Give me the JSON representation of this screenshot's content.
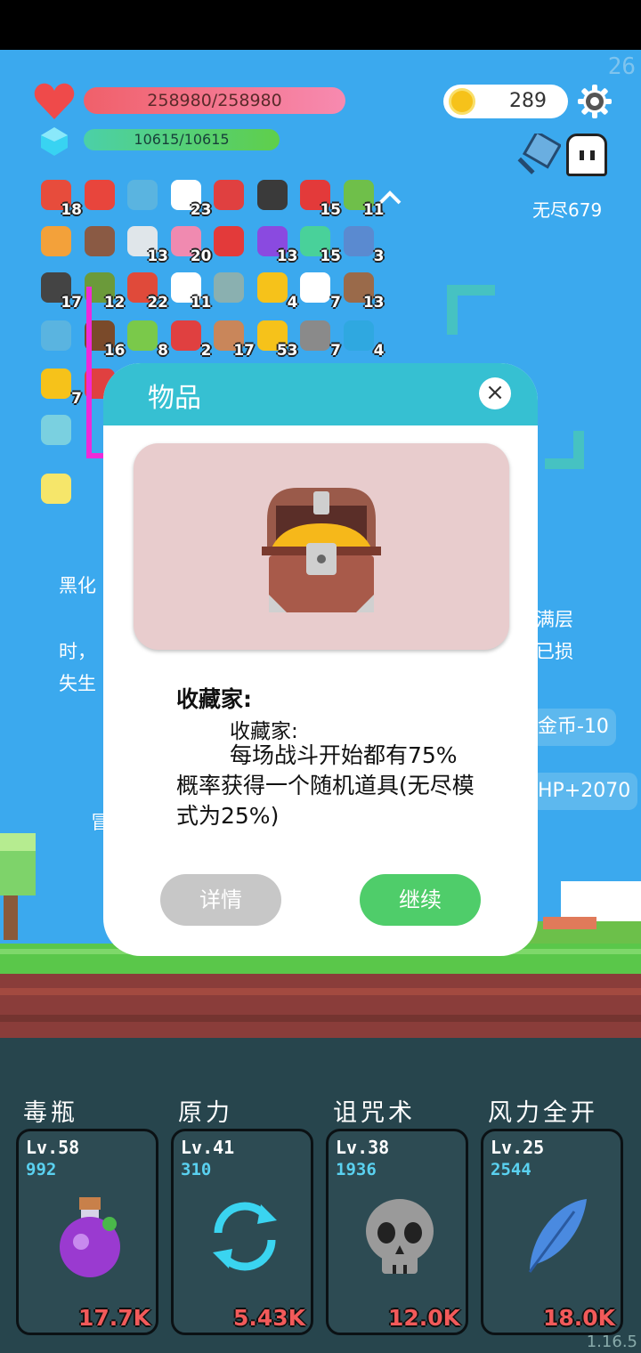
{
  "status": {
    "fps": "26",
    "version": "1.16.5"
  },
  "player": {
    "hp_text": "258980/258980",
    "mp_text": "10615/10615"
  },
  "currency": {
    "coins": "289"
  },
  "mode": {
    "endless_label": "无尽679"
  },
  "inventory": [
    {
      "icon": "watermelon-icon",
      "count": "18",
      "color": "#e74c3c"
    },
    {
      "icon": "sneaker-icon",
      "count": "",
      "color": "#e8453c"
    },
    {
      "icon": "magnifier-icon",
      "count": "",
      "color": "#5ab4e0"
    },
    {
      "icon": "egg-icon",
      "count": "23",
      "color": "#ffffff"
    },
    {
      "icon": "map-pin-icon",
      "count": "",
      "color": "#e04040"
    },
    {
      "icon": "knight-helmet-icon",
      "count": "",
      "color": "#3a3a3a"
    },
    {
      "icon": "mushroom-icon",
      "count": "15",
      "color": "#e33a3a"
    },
    {
      "icon": "zombie-icon",
      "count": "11",
      "color": "#6fbf4a"
    },
    {
      "icon": "torch-icon",
      "count": "",
      "color": "#f3a13a"
    },
    {
      "icon": "treasure-chest-icon",
      "count": "",
      "color": "#8a5a44"
    },
    {
      "icon": "stopwatch-icon",
      "count": "13",
      "color": "#e0e6ea"
    },
    {
      "icon": "ice-cream-icon",
      "count": "20",
      "color": "#f08ab0"
    },
    {
      "icon": "magnet-icon",
      "count": "",
      "color": "#e33a3a"
    },
    {
      "icon": "crystal-ball-icon",
      "count": "13",
      "color": "#8a4ae0"
    },
    {
      "icon": "potion-flask-icon",
      "count": "15",
      "color": "#49d19a"
    },
    {
      "icon": "shield-icon",
      "count": "3",
      "color": "#5a8ad0"
    },
    {
      "icon": "piggy-bank-icon",
      "count": "17",
      "color": "#444444"
    },
    {
      "icon": "grenade-icon",
      "count": "12",
      "color": "#6b9a3a"
    },
    {
      "icon": "sock-icon",
      "count": "22",
      "color": "#e04a3a"
    },
    {
      "icon": "cloud-icon",
      "count": "11",
      "color": "#ffffff"
    },
    {
      "icon": "ring-icon",
      "count": "",
      "color": "#8ab0b0"
    },
    {
      "icon": "magic-wand-icon",
      "count": "4",
      "color": "#f6c21a"
    },
    {
      "icon": "ghost-icon",
      "count": "7",
      "color": "#ffffff"
    },
    {
      "icon": "flag-cake-icon",
      "count": "13",
      "color": "#9a6a4a"
    },
    {
      "icon": "speech-bubble-icon",
      "count": "",
      "color": "#5ab4e0"
    },
    {
      "icon": "coconut-icon",
      "count": "16",
      "color": "#7a4a2a"
    },
    {
      "icon": "lime-icon",
      "count": "8",
      "color": "#7ac94a"
    },
    {
      "icon": "thermometer-icon",
      "count": "2",
      "color": "#e04040"
    },
    {
      "icon": "donut-icon",
      "count": "17",
      "color": "#c9865a"
    },
    {
      "icon": "crown-icon",
      "count": "53",
      "color": "#f6c21a"
    },
    {
      "icon": "compass-icon",
      "count": "7",
      "color": "#8a8a8a"
    },
    {
      "icon": "gem-icon",
      "count": "4",
      "color": "#2fa8e0"
    },
    {
      "icon": "sunflower-icon",
      "count": "7",
      "color": "#f6c21a"
    },
    {
      "icon": "pill-icon",
      "count": "",
      "color": "#e04040"
    },
    {
      "icon": "hand-icon",
      "count": "",
      "color": "#f0c89a"
    },
    {
      "icon": "bubble-flask-icon",
      "count": "",
      "color": "#7ad0e0"
    },
    {
      "icon": "lamp-icon",
      "count": "",
      "color": "#f6e66a"
    }
  ],
  "background_text": {
    "left_line1": "黑化",
    "left_line2": "时，",
    "left_line3": "失生",
    "right_line1": "满层",
    "right_line2": "已损",
    "hero_label": "冒"
  },
  "reward_buttons": {
    "coins": "金币-10",
    "hp": "HP+2070"
  },
  "dialog": {
    "title": "物品",
    "close": "×",
    "item_name": "收藏家:",
    "item_subtitle": "收藏家:",
    "description": "每场战斗开始都有75%概率获得一个随机道具(无尽模式为25%)",
    "detail_button": "详情",
    "continue_button": "继续"
  },
  "skills": [
    {
      "name": "毒瓶",
      "level": "Lv.58",
      "value": "992",
      "damage": "17.7K",
      "icon": "poison-bottle-icon"
    },
    {
      "name": "原力",
      "level": "Lv.41",
      "value": "310",
      "damage": "5.43K",
      "icon": "force-cycle-icon"
    },
    {
      "name": "诅咒术",
      "level": "Lv.38",
      "value": "1936",
      "damage": "12.0K",
      "icon": "skull-icon"
    },
    {
      "name": "风力全开",
      "level": "Lv.25",
      "value": "2544",
      "damage": "18.0K",
      "icon": "feather-icon"
    }
  ]
}
